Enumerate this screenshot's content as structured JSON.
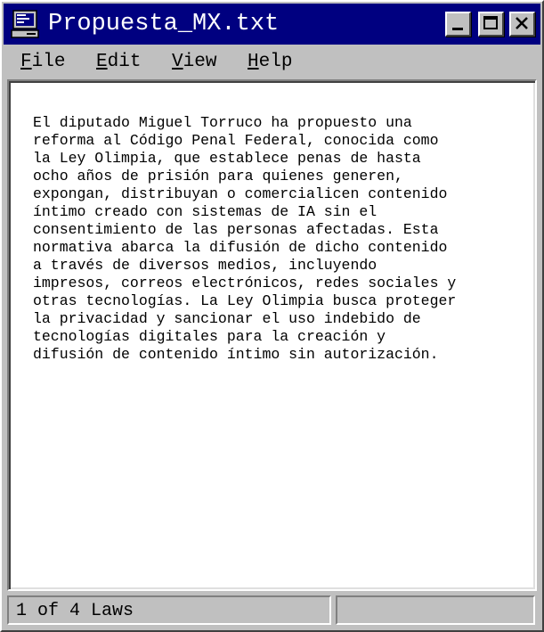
{
  "window": {
    "title": "Propuesta_MX.txt",
    "icon": "notepad-computer-icon",
    "controls": [
      "minimize-icon",
      "maximize-icon",
      "close-icon"
    ]
  },
  "menu": {
    "file": {
      "key": "F",
      "rest": "ile"
    },
    "edit": {
      "key": "E",
      "rest": "dit"
    },
    "view": {
      "key": "V",
      "rest": "iew"
    },
    "help": {
      "key": "H",
      "rest": "elp"
    }
  },
  "document": {
    "text": "El diputado Miguel Torruco ha propuesto una\nreforma al Código Penal Federal, conocida como\nla Ley Olimpia, que establece penas de hasta\nocho años de prisión para quienes generen,\nexpongan, distribuyan o comercialicen contenido\níntimo creado con sistemas de IA sin el\nconsentimiento de las personas afectadas. Esta\nnormativa abarca la difusión de dicho contenido\na través de diversos medios, incluyendo\nimpresos, correos electrónicos, redes sociales y\notras tecnologías. La Ley Olimpia busca proteger\nla privacidad y sancionar el uso indebido de\ntecnologías digitales para la creación y\ndifusión de contenido íntimo sin autorización."
  },
  "status": {
    "left": "1 of 4 Laws",
    "right": ""
  },
  "colors": {
    "titlebar": "#000080",
    "face": "#c0c0c0",
    "editor_bg": "#ffffff"
  }
}
